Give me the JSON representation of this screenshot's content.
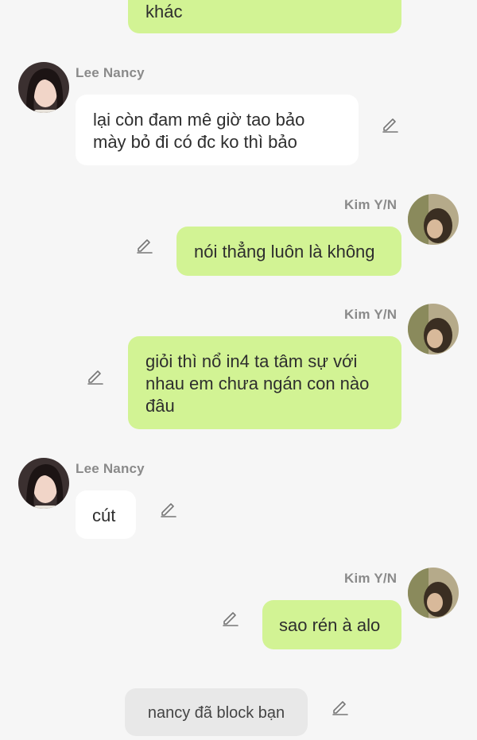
{
  "messages": [
    {
      "sender": "",
      "text": "khác"
    },
    {
      "sender": "Lee Nancy",
      "text": "lại còn đam mê giờ tao bảo mày bỏ đi có đc ko thì bảo"
    },
    {
      "sender": "Kim Y/N",
      "text": "nói thẳng luôn là không"
    },
    {
      "sender": "Kim Y/N",
      "text": "giỏi thì nổ in4 ta tâm sự với nhau em chưa ngán con nào đâu"
    },
    {
      "sender": "Lee Nancy",
      "text": "cút"
    },
    {
      "sender": "Kim Y/N",
      "text": "sao rén à alo"
    }
  ],
  "system_message": "nancy đã block bạn",
  "icons": {
    "edit": "pencil-edit-icon",
    "avatar_nancy": "avatar-lee-nancy",
    "avatar_kim": "avatar-kim-yn"
  },
  "colors": {
    "background": "#f6f6f6",
    "sent_bubble": "#d2f394",
    "received_bubble": "#ffffff",
    "system_bubble": "#e8e8e8",
    "name_text": "#8a8a8a"
  }
}
